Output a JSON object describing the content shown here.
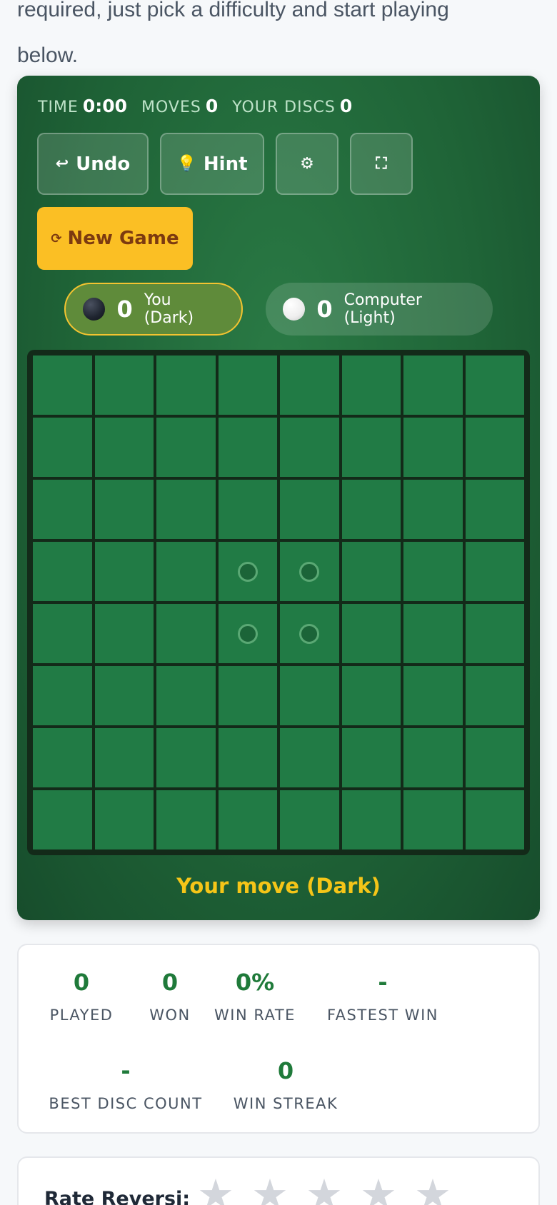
{
  "intro": {
    "line1": "required, just pick a difficulty and start playing",
    "line2": "below."
  },
  "top_stats": {
    "time_label": "TIME",
    "time_value": "0:00",
    "moves_label": "MOVES",
    "moves_value": "0",
    "discs_label": "YOUR DISCS",
    "discs_value": "0"
  },
  "controls": {
    "undo": {
      "icon": "↩",
      "label": "Undo"
    },
    "hint": {
      "icon": "💡",
      "label": "Hint"
    },
    "settings": {
      "icon": "⚙"
    },
    "fullscreen": {
      "icon": "⛶"
    },
    "new_game": {
      "icon": "⟳",
      "label": "New Game"
    }
  },
  "players": {
    "dark": {
      "score": "0",
      "label": "You (Dark)"
    },
    "light": {
      "score": "0",
      "label": "Computer (Light)"
    }
  },
  "board": {
    "size": 8,
    "hint_cells": [
      [
        3,
        3
      ],
      [
        3,
        4
      ],
      [
        4,
        3
      ],
      [
        4,
        4
      ]
    ],
    "discs": []
  },
  "status": "Your move (Dark)",
  "stats": [
    {
      "value": "0",
      "label": "PLAYED"
    },
    {
      "value": "0",
      "label": "WON"
    },
    {
      "value": "0%",
      "label": "WIN RATE"
    },
    {
      "value": "-",
      "label": "FASTEST WIN"
    },
    {
      "value": "-",
      "label": "BEST DISC COUNT"
    },
    {
      "value": "0",
      "label": "WIN STREAK"
    }
  ],
  "rating": {
    "label": "Rate Reversi:",
    "stars": 5,
    "selected": 0
  },
  "colors": {
    "panel_green": "#1f6437",
    "cell_green": "#217b45",
    "accent_yellow": "#fbbf24",
    "stat_green": "#1f7a3a"
  }
}
